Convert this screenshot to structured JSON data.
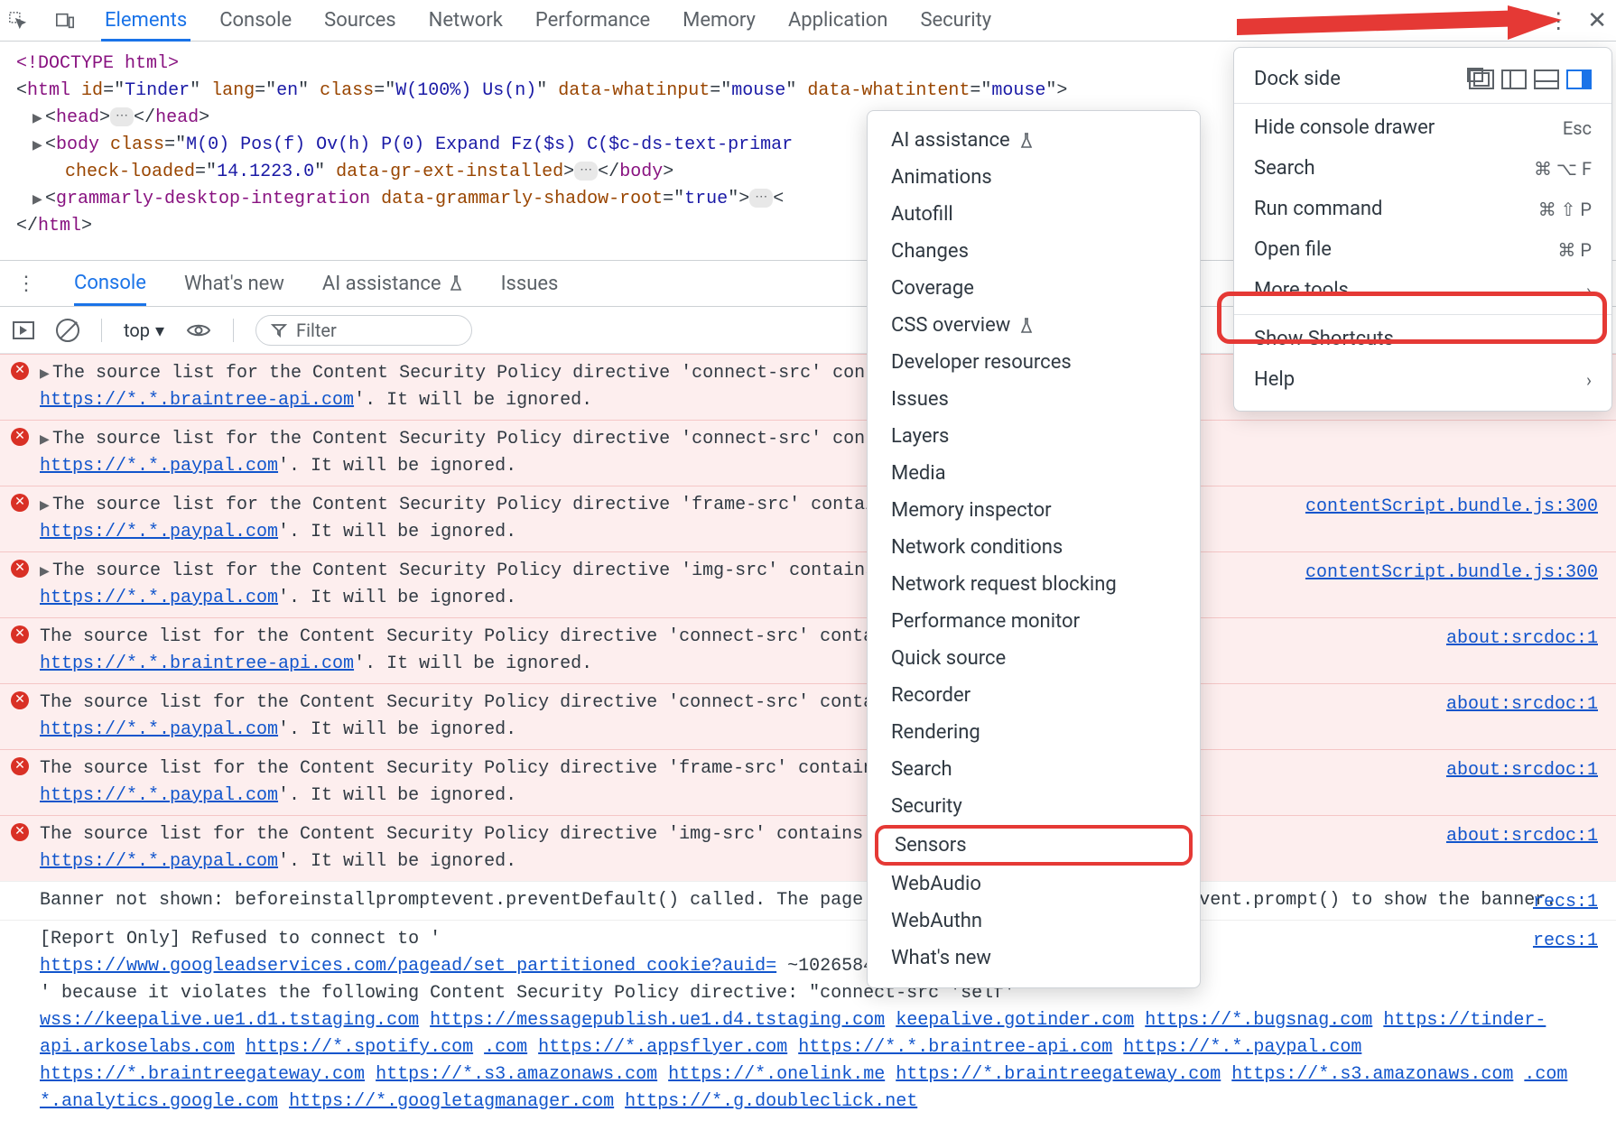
{
  "top_tabs": {
    "elements": "Elements",
    "console": "Console",
    "sources": "Sources",
    "network": "Network",
    "performance": "Performance",
    "memory": "Memory",
    "application": "Application",
    "security": "Security"
  },
  "dom": {
    "doctype": "<!DOCTYPE html>",
    "html_open": "<html id=\"Tinder\" lang=\"en\" class=\"W(100%) Us(n)\" data-whatinput=\"mouse\" data-whatintent=\"mouse\">",
    "head": "<head>…</head>",
    "body": "<body class=\"M(0) Pos(f) Ov(h) P(0) Expand Fz($s) C($c-ds-text-primary)\" data-new-gr-c-s-check-loaded=\"14.1223.0\" data-gr-ext-installed>…</body>",
    "grammarly": "<grammarly-desktop-integration data-grammarly-shadow-root=\"true\">…</grammarly-desktop-integration>",
    "html_close": "</html>"
  },
  "mid_tabs": {
    "console": "Console",
    "whatsnew": "What's new",
    "ai": "AI assistance",
    "issues": "Issues"
  },
  "console_toolbar": {
    "context": "top",
    "filter_placeholder": "Filter"
  },
  "settings_menu": {
    "dock_side": "Dock side",
    "hide_drawer": "Hide console drawer",
    "hide_drawer_sc": "Esc",
    "search": "Search",
    "search_sc": "⌘ ⌥ F",
    "run_cmd": "Run command",
    "run_cmd_sc": "⌘ ⇧ P",
    "open_file": "Open file",
    "open_file_sc": "⌘ P",
    "more_tools": "More tools",
    "show_shortcuts": "Show Shortcuts",
    "help": "Help"
  },
  "submenu": [
    "AI assistance",
    "Animations",
    "Autofill",
    "Changes",
    "Coverage",
    "CSS overview",
    "Developer resources",
    "Issues",
    "Layers",
    "Media",
    "Memory inspector",
    "Network conditions",
    "Network request blocking",
    "Performance monitor",
    "Quick source",
    "Recorder",
    "Rendering",
    "Search",
    "Security",
    "Sensors",
    "WebAudio",
    "WebAuthn",
    "What's new"
  ],
  "messages": [
    {
      "type": "err",
      "expand": true,
      "text": "The source list for the Content Security Policy directive 'connect-src' contains an invalid source: '",
      "link": "https://*.*.braintree-api.com",
      "tail": "'. It will be ignored."
    },
    {
      "type": "err",
      "expand": true,
      "text": "The source list for the Content Security Policy directive 'connect-src' contains an invalid source: '",
      "link": "https://*.*.paypal.com",
      "tail": "'. It will be ignored."
    },
    {
      "type": "err",
      "expand": true,
      "text": "The source list for the Content Security Policy directive 'frame-src' contains an invalid source: '",
      "link": "https://*.*.paypal.com",
      "tail": "'. It will be ignored.",
      "right": "contentScript.bundle.js:300"
    },
    {
      "type": "err",
      "expand": true,
      "text": "The source list for the Content Security Policy directive 'img-src' contains an invalid source: '",
      "link": "https://*.*.paypal.com",
      "tail": "'. It will be ignored.",
      "right": "contentScript.bundle.js:300"
    },
    {
      "type": "err",
      "expand": false,
      "text": "The source list for the Content Security Policy directive 'connect-src' contains an invalid source: '",
      "link": "https://*.*.braintree-api.com",
      "tail": "'. It will be ignored.",
      "right": "about:srcdoc:1"
    },
    {
      "type": "err",
      "expand": false,
      "text": "The source list for the Content Security Policy directive 'connect-src' contains an invalid source: '",
      "link": "https://*.*.paypal.com",
      "tail": "'. It will be ignored.",
      "right": "about:srcdoc:1"
    },
    {
      "type": "err",
      "expand": false,
      "text": "The source list for the Content Security Policy directive 'frame-src' contains an invalid source: '",
      "link": "https://*.*.paypal.com",
      "tail": "'. It will be ignored.",
      "right": "about:srcdoc:1"
    },
    {
      "type": "err",
      "expand": false,
      "text": "The source list for the Content Security Policy directive 'img-src' contains an invalid source: '",
      "link": "https://*.*.paypal.com",
      "tail": "'. It will be ignored.",
      "right": "about:srcdoc:1"
    }
  ],
  "plain_messages": {
    "banner": "Banner not shown: beforeinstallpromptevent.preventDefault() called. The page must call beforeinstallpromptevent.prompt() to show the banner.",
    "banner_right": "recs:1",
    "report_only": "[Report Only] Refused to connect to '",
    "report_link": "https://www.googleadservices.com/pagead/set_partitioned_cookie?auid=",
    "report_tail1": "~102658452&apve=1&gcd=13l3l3…",
    "report_tail2": "' because it violates the following Content Security Policy directive: \"connect-src 'self' ",
    "report_right": "recs:1",
    "urls": [
      "wss://keepalive.ue1.d1.tstaging.com",
      "https://messagepublish.ue1.d4.tstaging.com",
      "keepalive.gotinder.com",
      "https://*.bugsnag.com",
      "https://tinder-api.arkoselabs.com",
      "https://*.spotify.com",
      ".com",
      "https://*.appsflyer.com",
      "https://*.*.braintree-api.com",
      "https://*.*.paypal.com",
      "https://*.braintreegateway.com",
      "https://*.s3.amazonaws.com",
      "https://*.onelink.me",
      "https://*.braintreegateway.com",
      "https://*.s3.amazonaws.com",
      ".com",
      "*.analytics.google.com",
      "https://*.googletagmanager.com",
      "https://*.g.doubleclick.net"
    ]
  }
}
